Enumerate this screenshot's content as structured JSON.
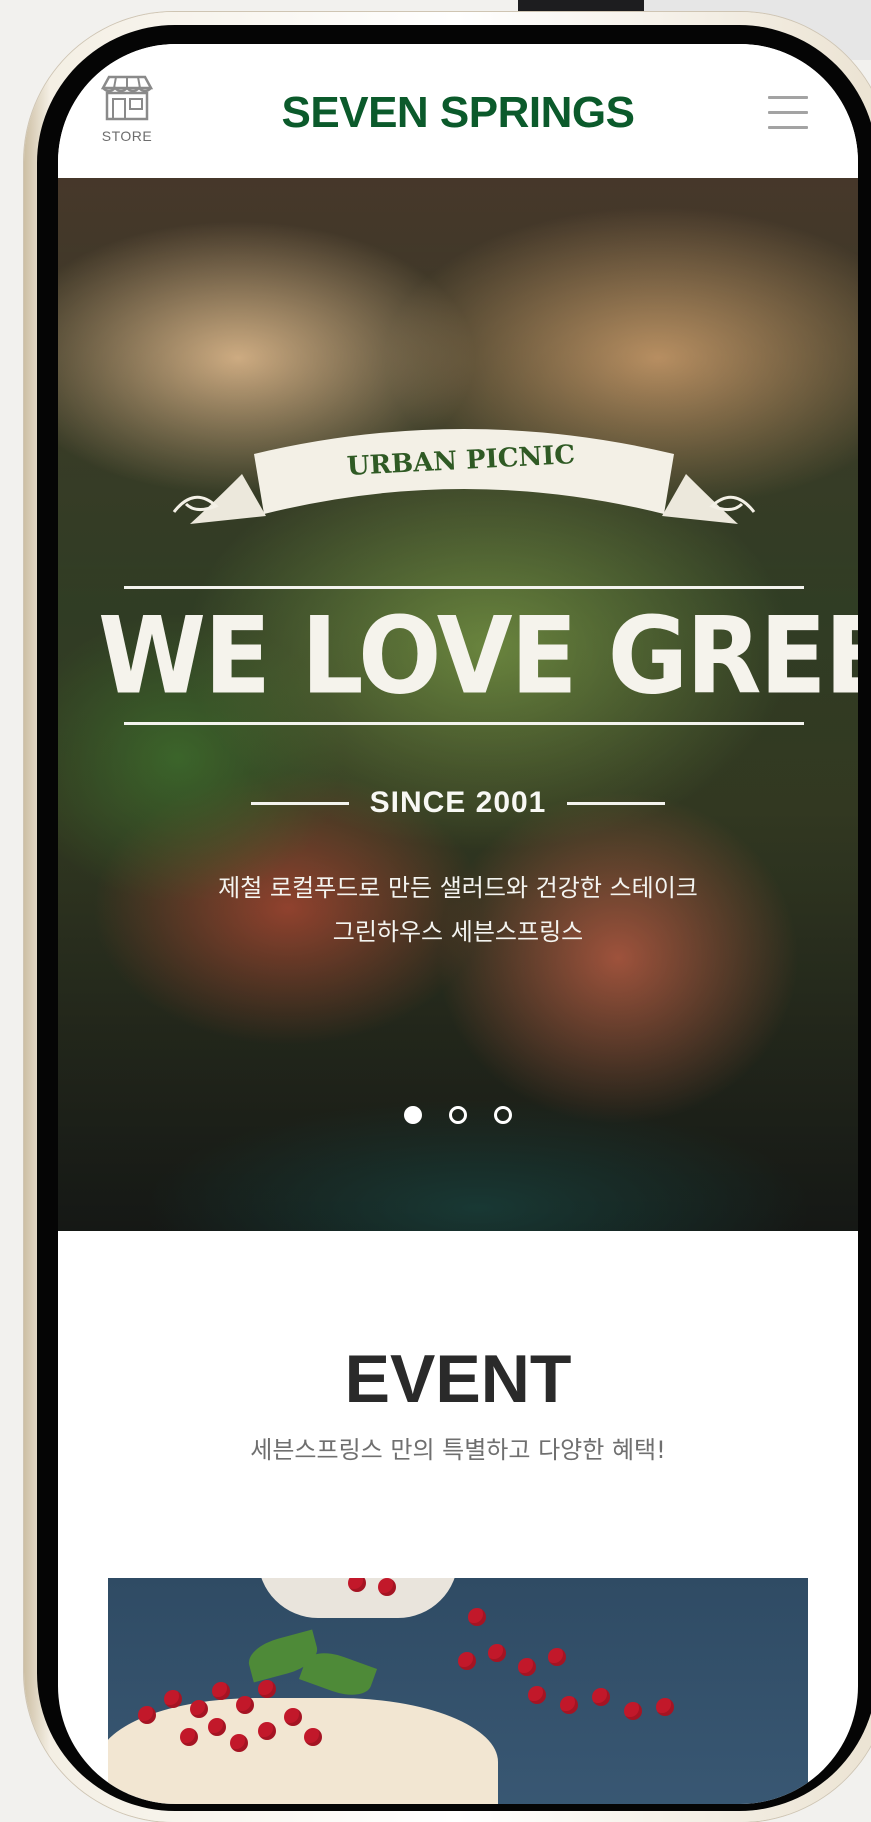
{
  "header": {
    "store_label": "STORE",
    "brand": "SEVEN SPRINGS",
    "brand_color": "#0b5a2b",
    "store_icon": "store-icon",
    "menu_icon": "hamburger-menu-icon"
  },
  "hero": {
    "ribbon": "URBAN PICNIC",
    "headline": "WE LOVE GREEN",
    "since": "SINCE 2001",
    "desc_line1": "제철 로컬푸드로 만든 샐러드와 건강한 스테이크",
    "desc_line2": "그린하우스 세븐스프링스",
    "slides": {
      "count": 3,
      "active": 1
    }
  },
  "event": {
    "title": "EVENT",
    "subtitle": "세븐스프링스 만의 특별하고 다양한 혜택!"
  }
}
